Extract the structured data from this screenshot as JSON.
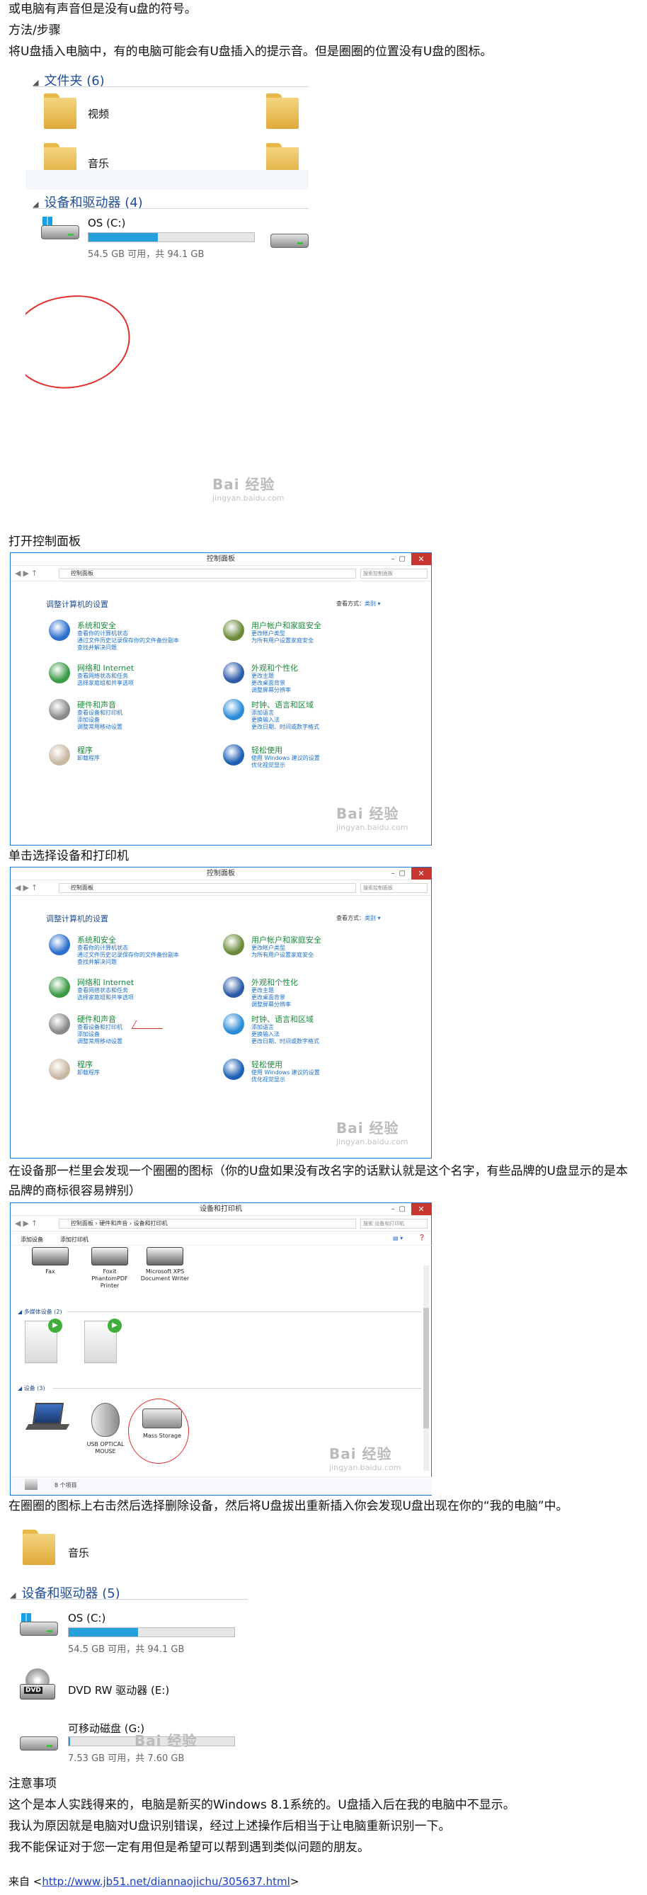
{
  "intro_line": "或电脑有声音但是没有u盘的符号。",
  "method_heading": "方法/步骤",
  "step1": "将U盘插入电脑中，有的电脑可能会有U盘插入的提示音。但是圈圈的位置没有U盘的图标。",
  "shot1": {
    "folders_section": "文件夹 (6)",
    "folder_video": "视频",
    "folder_music": "音乐",
    "devices_section": "设备和驱动器 (4)",
    "drive_name": "OS (C:)",
    "drive_space": "54.5 GB 可用，共 94.1 GB",
    "drive_fill": 0.42
  },
  "step2": "打开控制面板",
  "cp": {
    "title": "控制面板",
    "address": "控制面板",
    "search_placeholder": "搜索控制面板",
    "heading": "调整计算机的设置",
    "view_label": "查看方式：",
    "view_value": "类别 ▾",
    "cats_left": [
      {
        "title": "系统和安全",
        "links": [
          "查看你的计算机状态",
          "通过文件历史记录保存你的文件备份副本",
          "查找并解决问题"
        ]
      },
      {
        "title": "网络和 Internet",
        "links": [
          "查看网络状态和任务",
          "选择家庭组和共享选项"
        ]
      },
      {
        "title": "硬件和声音",
        "links": [
          "查看设备和打印机",
          "添加设备",
          "调整常用移动设置"
        ]
      },
      {
        "title": "程序",
        "links": [
          "卸载程序"
        ]
      }
    ],
    "cats_right": [
      {
        "title": "用户帐户和家庭安全",
        "links": [
          "更改帐户类型",
          "为所有用户设置家庭安全"
        ]
      },
      {
        "title": "外观和个性化",
        "links": [
          "更改主题",
          "更改桌面背景",
          "调整屏幕分辨率"
        ]
      },
      {
        "title": "时钟、语言和区域",
        "links": [
          "添加语言",
          "更换输入法",
          "更改日期、时间或数字格式"
        ]
      },
      {
        "title": "轻松使用",
        "links": [
          "使用 Windows 建议的设置",
          "优化视觉显示"
        ]
      }
    ]
  },
  "step3": "单击选择设备和打印机",
  "step4": "在设备那一栏里会发现一个圈圈的图标（你的U盘如果没有改名字的话默认就是这个名字，有些品牌的U盘显示的是本品牌的商标很容易辨别）",
  "dp": {
    "title": "设备和打印机",
    "address": "控制面板 › 硬件和声音 › 设备和打印机",
    "search_placeholder": "搜索 设备和打印机",
    "toolbar_add_device": "添加设备",
    "toolbar_add_printer": "添加打印机",
    "printers": [
      "Fax",
      "Foxit PhantomPDF Printer",
      "Microsoft XPS Document Writer"
    ],
    "multimedia_section": "多媒体设备 (2)",
    "devices_section": "设备 (3)",
    "devices": [
      "",
      "USB OPTICAL MOUSE",
      "Mass Storage"
    ],
    "status": "8 个项目"
  },
  "step5": "在圈圈的图标上右击然后选择删除设备，然后将U盘拔出重新插入你会发现U盘出现在你的“我的电脑”中。",
  "shot5": {
    "folder_music": "音乐",
    "devices_section": "设备和驱动器 (5)",
    "drive_c": "OS (C:)",
    "drive_c_space": "54.5 GB 可用，共 94.1 GB",
    "drive_c_fill": 0.42,
    "drive_dvd": "DVD RW 驱动器 (E:)",
    "drive_usb": "可移动磁盘 (G:)",
    "drive_usb_space": "7.53 GB 可用，共 7.60 GB",
    "drive_usb_fill": 0.01
  },
  "notes_heading": "注意事项",
  "note1": "这个是本人实践得来的，电脑是新买的Windows 8.1系统的。U盘插入后在我的电脑中不显示。",
  "note2": "我认为原因就是电脑对U盘识别错误，经过上述操作后相当于让电脑重新识别一下。",
  "note3": "我不能保证对于您一定有用但是希望可以帮到遇到类似问题的朋友。",
  "source_prefix": "来自 <",
  "source_url": "http://www.jb51.net/diannaojichu/305637.html",
  "source_suffix": ">",
  "watermark": "Bai 经验",
  "watermark_sub": "jingyan.baidu.com"
}
